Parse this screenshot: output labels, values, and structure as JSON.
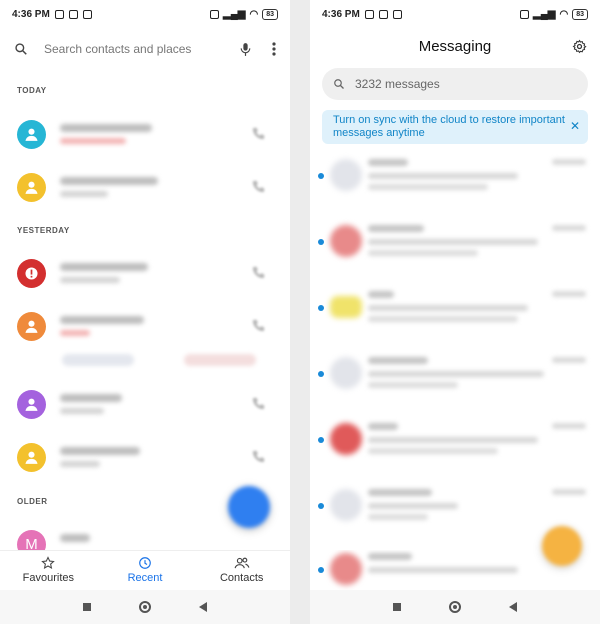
{
  "left_screen": {
    "status": {
      "time": "4:36 PM",
      "battery": "83"
    },
    "search": {
      "placeholder": "Search contacts and places"
    },
    "sections": {
      "today": "TODAY",
      "yesterday": "YESTERDAY",
      "older": "OLDER"
    },
    "avatar_initial": "M",
    "colors": {
      "cyan": "#26b6d5",
      "yellow": "#f3c12d",
      "red": "#d32f2f",
      "orange": "#ef8a3b",
      "purple": "#a462de",
      "pink": "#e573b7",
      "accent": "#1a73e8"
    },
    "bottom_nav": {
      "favourites": "Favourites",
      "recent": "Recent",
      "contacts": "Contacts"
    }
  },
  "right_screen": {
    "status": {
      "time": "4:36 PM",
      "battery": "83"
    },
    "title": "Messaging",
    "search": {
      "placeholder": "3232 messages"
    },
    "sync_banner": {
      "text": "Turn on sync with the cloud to restore important messages anytime",
      "close": "✕"
    },
    "colors": {
      "banner_bg": "#dff1fb",
      "banner_text": "#1185c7",
      "unread": "#1a8ad8"
    }
  }
}
